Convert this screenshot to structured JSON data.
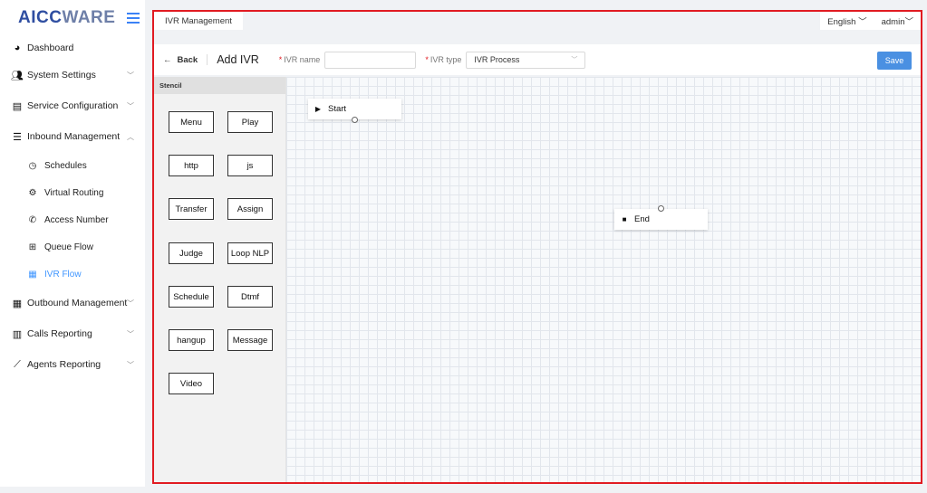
{
  "brand": {
    "logo_part1": "AICC",
    "logo_part2": "WARE"
  },
  "sidebar": {
    "items": [
      {
        "label": "Dashboard",
        "icon": "dashboard-icon"
      },
      {
        "label": "System Settings",
        "icon": "users-icon"
      },
      {
        "label": "Service Configuration",
        "icon": "id-card-icon"
      },
      {
        "label": "Inbound Management",
        "icon": "list-icon"
      },
      {
        "label": "Outbound Management",
        "icon": "table-icon"
      },
      {
        "label": "Calls Reporting",
        "icon": "bar-chart-icon"
      },
      {
        "label": "Agents Reporting",
        "icon": "line-chart-icon"
      }
    ],
    "inbound_sub": [
      {
        "label": "Schedules",
        "icon": "clock-icon"
      },
      {
        "label": "Virtual Routing",
        "icon": "gear-icon"
      },
      {
        "label": "Access Number",
        "icon": "phone-icon"
      },
      {
        "label": "Queue Flow",
        "icon": "queue-icon"
      },
      {
        "label": "IVR Flow",
        "icon": "film-icon"
      }
    ],
    "active_sub": "IVR Flow"
  },
  "tabs": {
    "current": "IVR Management"
  },
  "topbar": {
    "language": "English",
    "user": "admin"
  },
  "toolbar": {
    "back_label": "Back",
    "title": "Add IVR",
    "ivr_name_label": "IVR name",
    "ivr_name_value": "",
    "ivr_type_label": "IVR type",
    "ivr_type_value": "IVR Process",
    "save_label": "Save"
  },
  "stencil": {
    "header": "Stencil",
    "components": [
      "Menu",
      "Play",
      "http",
      "js",
      "Transfer",
      "Assign",
      "Judge",
      "Loop NLP",
      "Schedule",
      "Dtmf",
      "hangup",
      "Message",
      "Video"
    ]
  },
  "canvas": {
    "nodes": [
      {
        "label": "Start",
        "type": "start"
      },
      {
        "label": "End",
        "type": "end"
      }
    ]
  },
  "colors": {
    "accent": "#4a90e2",
    "active": "#4096ff",
    "highlight_border": "#e11b22",
    "logo_primary": "#2f4ea1"
  }
}
